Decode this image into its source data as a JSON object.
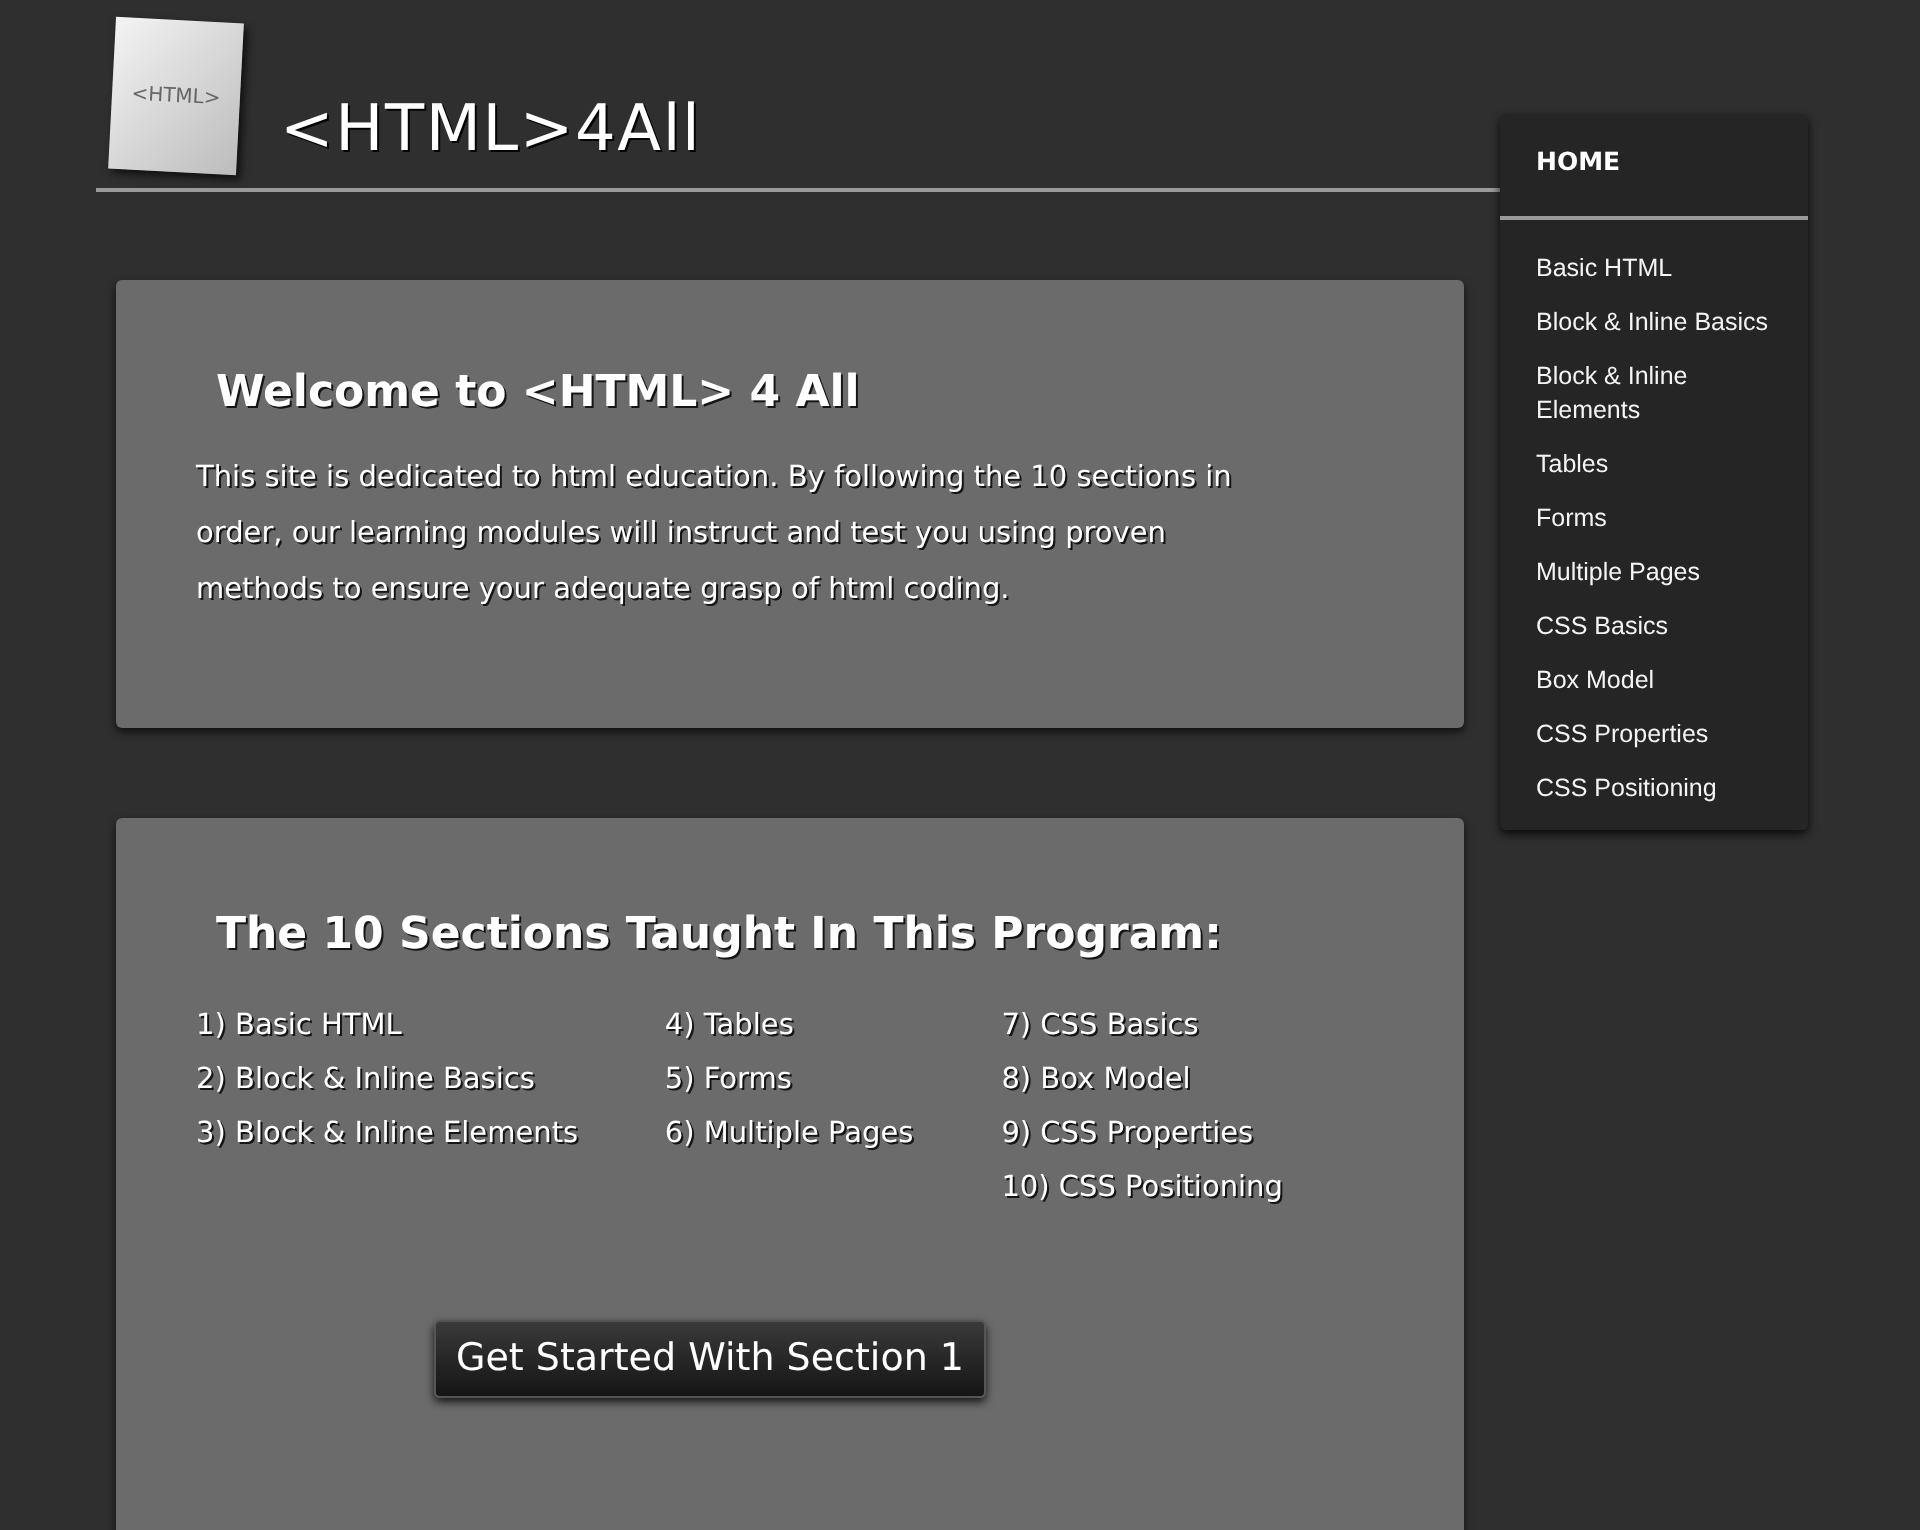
{
  "logo": {
    "badge": "<HTML>",
    "title": "<HTML>4All"
  },
  "nav": {
    "home": {
      "label": "HOME",
      "selected": true
    },
    "items": [
      {
        "label": "Basic HTML",
        "selected": false
      },
      {
        "label": "Block & Inline Basics",
        "selected": false
      },
      {
        "label": "Block & Inline Elements",
        "selected": false
      },
      {
        "label": "Tables",
        "selected": false
      },
      {
        "label": "Forms",
        "selected": false
      },
      {
        "label": "Multiple Pages",
        "selected": false
      },
      {
        "label": "CSS Basics",
        "selected": false
      },
      {
        "label": "Box Model",
        "selected": false
      },
      {
        "label": "CSS Properties",
        "selected": false
      },
      {
        "label": "CSS Positioning",
        "selected": false
      }
    ]
  },
  "welcome": {
    "heading": "Welcome to <HTML> 4 All",
    "text": "This site is dedicated to html education. By following the 10 sections in order, our learning modules will instruct and test you using proven methods to ensure your adequate grasp of html coding."
  },
  "sections": {
    "heading": "The 10 Sections Taught In This Program:",
    "columns": [
      [
        "1) Basic HTML",
        "2) Block & Inline Basics",
        "3) Block & Inline Elements"
      ],
      [
        "4) Tables",
        "5) Forms",
        "6) Multiple Pages"
      ],
      [
        "7) CSS Basics",
        "8) Box Model",
        "9) CSS Properties",
        "10) CSS Positioning"
      ]
    ],
    "button": "Get Started With Section 1"
  }
}
